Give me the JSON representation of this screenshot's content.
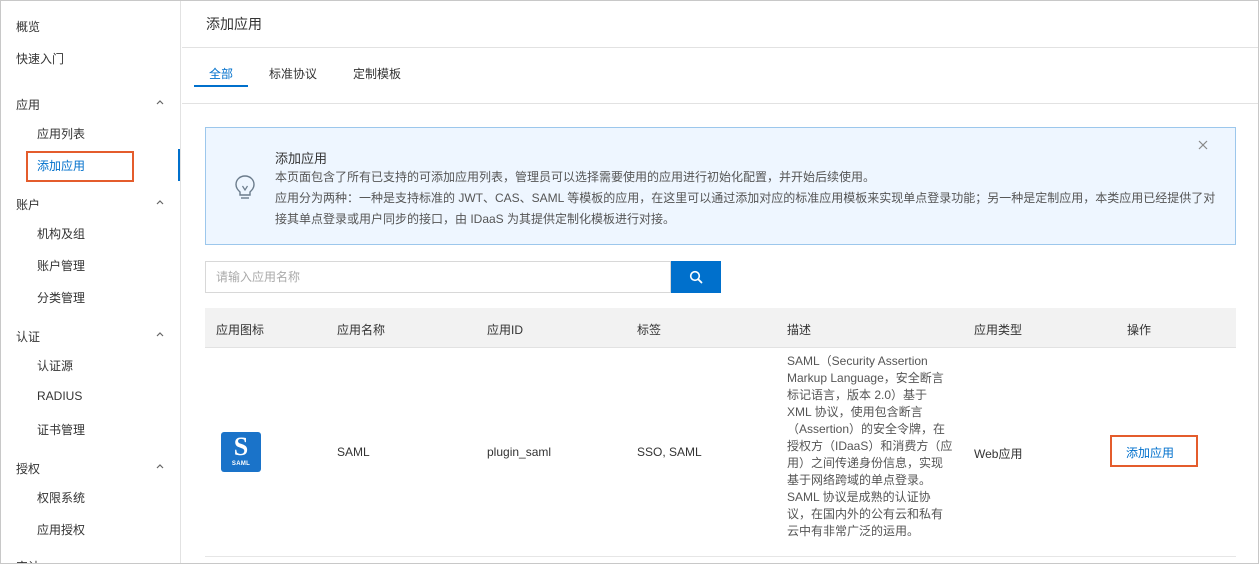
{
  "sidebar": {
    "top_items": [
      "概览",
      "快速入门"
    ],
    "groups": [
      {
        "label": "应用",
        "items": [
          "应用列表",
          "添加应用"
        ]
      },
      {
        "label": "账户",
        "items": [
          "机构及组",
          "账户管理",
          "分类管理"
        ]
      },
      {
        "label": "认证",
        "items": [
          "认证源",
          "RADIUS",
          "证书管理"
        ]
      },
      {
        "label": "授权",
        "items": [
          "权限系统",
          "应用授权"
        ]
      },
      {
        "label": "审计"
      }
    ],
    "active_item": "添加应用"
  },
  "header": {
    "title": "添加应用"
  },
  "tabs": [
    {
      "label": "全部",
      "active": true
    },
    {
      "label": "标准协议",
      "active": false
    },
    {
      "label": "定制模板",
      "active": false
    }
  ],
  "notice": {
    "title": "添加应用",
    "lines": [
      "本页面包含了所有已支持的可添加应用列表，管理员可以选择需要使用的应用进行初始化配置，并开始后续使用。",
      "应用分为两种：一种是支持标准的 JWT、CAS、SAML 等模板的应用，在这里可以通过添加对应的标准应用模板来实现单点登录功能；另一种是定制应用，本类应用已经提供了对",
      "接其单点登录或用户同步的接口，由 IDaaS 为其提供定制化模板进行对接。"
    ]
  },
  "search": {
    "placeholder": "请输入应用名称"
  },
  "table": {
    "columns": [
      "应用图标",
      "应用名称",
      "应用ID",
      "标签",
      "描述",
      "应用类型",
      "操作"
    ],
    "rows": [
      {
        "icon_letter": "S",
        "icon_text": "SAML",
        "name": "SAML",
        "app_id": "plugin_saml",
        "tags": "SSO, SAML",
        "description_lines": [
          "SAML（Security Assertion",
          "Markup Language，安全断言",
          "标记语言，版本 2.0）基于",
          "XML 协议，使用包含断言",
          "（Assertion）的安全令牌，在",
          "授权方（IDaaS）和消费方（应",
          "用）之间传递身份信息，实现",
          "基于网络跨域的单点登录。",
          "SAML 协议是成熟的认证协",
          "议，在国内外的公有云和私有",
          "云中有非常广泛的运用。"
        ],
        "type": "Web应用",
        "action": "添加应用"
      }
    ]
  },
  "colors": {
    "accent": "#0070cc",
    "highlight": "#e45c2c",
    "notice_bg": "#eef6ff"
  },
  "icons": {
    "notice": "lightbulb-icon",
    "close": "close-icon",
    "search": "search-icon",
    "collapse": "chevron-up-icon"
  }
}
